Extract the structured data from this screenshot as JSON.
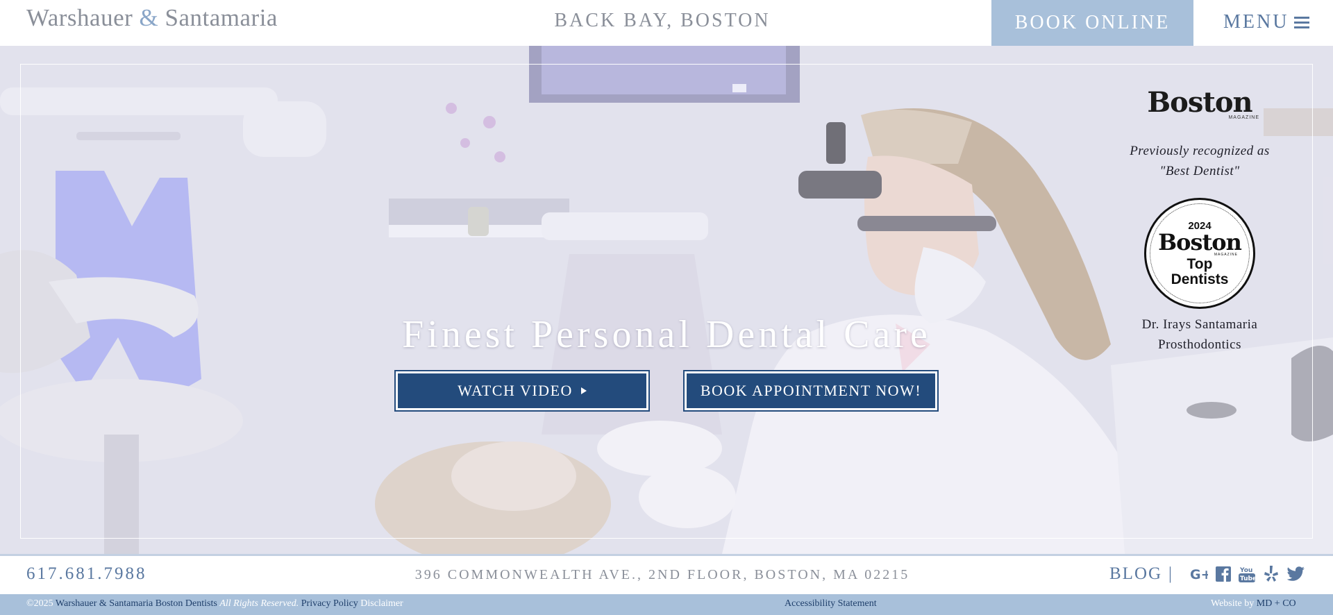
{
  "header": {
    "logo_part1": "Warshauer",
    "logo_amp": "&",
    "logo_part2": "Santamaria",
    "location": "BACK BAY, BOSTON",
    "book_online": "BOOK ONLINE",
    "menu": "MENU"
  },
  "hero": {
    "title": "Finest Personal Dental Care",
    "watch_video": "WATCH VIDEO",
    "book_appointment": "BOOK APPOINTMENT NOW!"
  },
  "award": {
    "magazine_logo": "Boston",
    "magazine_sub": "MAGAZINE",
    "recognized_line1": "Previously recognized as",
    "recognized_line2": "\"Best Dentist\"",
    "badge_year": "2024",
    "badge_magazine": "Boston",
    "badge_magazine_sub": "MAGAZINE",
    "badge_top": "Top",
    "badge_dentists": "Dentists",
    "doctor_name": "Dr. Irays Santamaria",
    "doctor_specialty": "Prosthodontics"
  },
  "info_bar": {
    "phone": "617.681.7988",
    "address": "396 COMMONWEALTH AVE., 2ND FLOOR, BOSTON, MA 02215",
    "blog": "BLOG",
    "separator": "|",
    "social_icons": [
      "google-plus-icon",
      "facebook-icon",
      "youtube-icon",
      "yelp-icon",
      "twitter-icon"
    ]
  },
  "footer": {
    "copyright": "©2025",
    "practice_link": "Warshauer & Santamaria Boston Dentists",
    "rights": "All Rights Reserved.",
    "privacy": "Privacy Policy",
    "disclaimer": "Disclaimer",
    "accessibility": "Accessibility Statement",
    "website_by": "Website by",
    "agency": "MD + CO"
  },
  "colors": {
    "accent_blue": "#a8c0da",
    "button_navy": "#234b7c",
    "link_blue": "#5a78a0",
    "gray_text": "#8a8f99"
  }
}
